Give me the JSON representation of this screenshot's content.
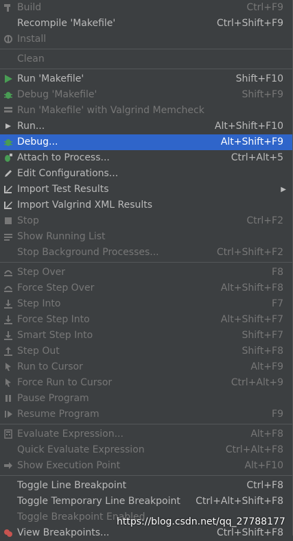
{
  "colors": {
    "background": "#3c3f41",
    "text": "#bbbbbb",
    "disabled_text": "#777777",
    "selected_bg": "#2f65ca"
  },
  "groups": [
    [
      {
        "label": "Build",
        "shortcut": "Ctrl+F9",
        "icon": "hammer-icon",
        "disabled": true
      },
      {
        "label": "Recompile 'Makefile'",
        "shortcut": "Ctrl+Shift+F9",
        "icon": "",
        "disabled": false
      },
      {
        "label": "Install",
        "shortcut": "",
        "icon": "install-icon",
        "disabled": true
      }
    ],
    [
      {
        "label": "Clean",
        "shortcut": "",
        "icon": "",
        "disabled": true
      }
    ],
    [
      {
        "label": "Run 'Makefile'",
        "shortcut": "Shift+F10",
        "icon": "run-icon",
        "disabled": false
      },
      {
        "label": "Debug 'Makefile'",
        "shortcut": "Shift+F9",
        "icon": "debug-icon",
        "disabled": true
      },
      {
        "label": "Run 'Makefile' with Valgrind Memcheck",
        "shortcut": "",
        "icon": "valgrind-icon",
        "disabled": true
      },
      {
        "label": "Run...",
        "shortcut": "Alt+Shift+F10",
        "icon": "run-small-icon",
        "disabled": false
      },
      {
        "label": "Debug...",
        "shortcut": "Alt+Shift+F9",
        "icon": "debug-icon",
        "disabled": false,
        "selected": true
      },
      {
        "label": "Attach to Process...",
        "shortcut": "Ctrl+Alt+5",
        "icon": "attach-icon",
        "disabled": false
      },
      {
        "label": "Edit Configurations...",
        "shortcut": "",
        "icon": "edit-icon",
        "disabled": false
      },
      {
        "label": "Import Test Results",
        "shortcut": "",
        "icon": "import-icon",
        "disabled": false,
        "submenu": true
      },
      {
        "label": "Import Valgrind XML Results",
        "shortcut": "",
        "icon": "import-icon",
        "disabled": false
      },
      {
        "label": "Stop",
        "shortcut": "Ctrl+F2",
        "icon": "stop-icon",
        "disabled": true
      },
      {
        "label": "Show Running List",
        "shortcut": "",
        "icon": "list-icon",
        "disabled": true
      },
      {
        "label": "Stop Background Processes...",
        "shortcut": "Ctrl+Shift+F2",
        "icon": "",
        "disabled": true
      }
    ],
    [
      {
        "label": "Step Over",
        "shortcut": "F8",
        "icon": "step-over-icon",
        "disabled": true
      },
      {
        "label": "Force Step Over",
        "shortcut": "Alt+Shift+F8",
        "icon": "step-over-icon",
        "disabled": true
      },
      {
        "label": "Step Into",
        "shortcut": "F7",
        "icon": "step-into-icon",
        "disabled": true
      },
      {
        "label": "Force Step Into",
        "shortcut": "Alt+Shift+F7",
        "icon": "step-into-icon",
        "disabled": true
      },
      {
        "label": "Smart Step Into",
        "shortcut": "Shift+F7",
        "icon": "step-into-icon",
        "disabled": true
      },
      {
        "label": "Step Out",
        "shortcut": "Shift+F8",
        "icon": "step-out-icon",
        "disabled": true
      },
      {
        "label": "Run to Cursor",
        "shortcut": "Alt+F9",
        "icon": "cursor-icon",
        "disabled": true
      },
      {
        "label": "Force Run to Cursor",
        "shortcut": "Ctrl+Alt+9",
        "icon": "cursor-icon",
        "disabled": true
      },
      {
        "label": "Pause Program",
        "shortcut": "",
        "icon": "pause-icon",
        "disabled": true
      },
      {
        "label": "Resume Program",
        "shortcut": "F9",
        "icon": "resume-icon",
        "disabled": true
      }
    ],
    [
      {
        "label": "Evaluate Expression...",
        "shortcut": "Alt+F8",
        "icon": "calculator-icon",
        "disabled": true
      },
      {
        "label": "Quick Evaluate Expression",
        "shortcut": "Ctrl+Alt+F8",
        "icon": "",
        "disabled": true
      },
      {
        "label": "Show Execution Point",
        "shortcut": "Alt+F10",
        "icon": "execution-point-icon",
        "disabled": true
      }
    ],
    [
      {
        "label": "Toggle Line Breakpoint",
        "shortcut": "Ctrl+F8",
        "icon": "",
        "disabled": false
      },
      {
        "label": "Toggle Temporary Line Breakpoint",
        "shortcut": "Ctrl+Alt+Shift+F8",
        "icon": "",
        "disabled": false
      },
      {
        "label": "Toggle Breakpoint Enabled",
        "shortcut": "",
        "icon": "",
        "disabled": true
      },
      {
        "label": "View Breakpoints...",
        "shortcut": "Ctrl+Shift+F8",
        "icon": "breakpoints-icon",
        "disabled": false
      }
    ]
  ],
  "watermark": "https://blog.csdn.net/qq_27788177"
}
